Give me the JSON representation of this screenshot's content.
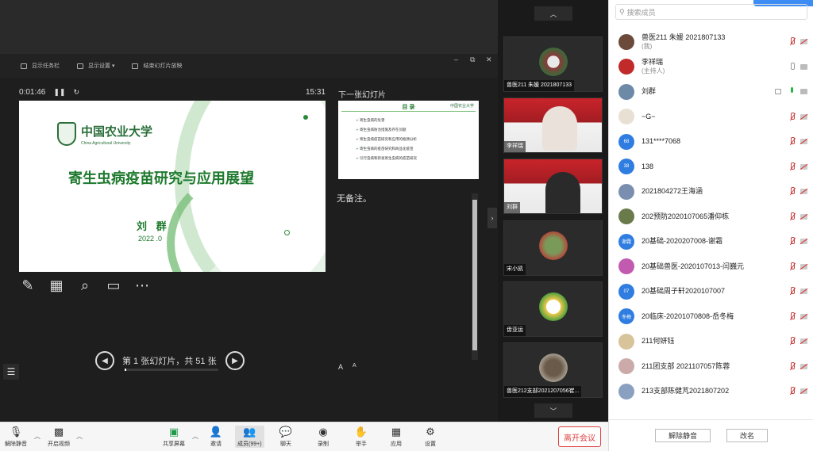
{
  "colors": {
    "accent_green": "#1f7a2e",
    "leave_red": "#e04040",
    "panel_bg": "#1e1e1e"
  },
  "presenter": {
    "toolbar": [
      "显示任务栏",
      "显示设置 ▾",
      "结束幻灯片放映"
    ],
    "window_controls": [
      "–",
      "⧉",
      "✕"
    ],
    "elapsed": "0:01:46",
    "clock": "15:31",
    "next_slide_label": "下一张幻灯片",
    "notes": "无备注。",
    "slide_counter": "第 1 张幻灯片，共 51 张",
    "progress_fraction": 0.02,
    "font_controls": [
      "A",
      "A"
    ]
  },
  "slide": {
    "logo_cn": "中国农业大学",
    "logo_en": "China Agricultural University",
    "title": "寄生虫病疫苗研究与应用展望",
    "author": "刘 群",
    "date": "2022 .0"
  },
  "next_slide": {
    "heading": "目 录",
    "logo": "中国农业大学",
    "items": [
      "寄生虫病的危害",
      "寄生虫病防治措施及存在问题",
      "寄生虫病疫苗研究和应用的瓶颈分析",
      "寄生虫病的疫苗研究和商品化疫苗",
      "引行虫病和新发寄生虫病的疫苗研究"
    ]
  },
  "videos": [
    {
      "name": "兽医211 朱媛 2021807133"
    },
    {
      "name": "李祥瑞"
    },
    {
      "name": "刘群"
    },
    {
      "name": "宋小凯"
    },
    {
      "name": "毋亚运"
    },
    {
      "name": "兽医212支部2021207056崔..."
    }
  ],
  "members": {
    "search_placeholder": "搜索成员",
    "list": [
      {
        "name": "兽医211 朱媛 2021807133",
        "sub": "(我)",
        "avatar": "",
        "avatar_color": "#6b4a3a"
      },
      {
        "name": "李祥瑞",
        "sub": "(主持人)",
        "avatar": "",
        "avatar_color": "#c02a2a"
      },
      {
        "name": "刘群",
        "sub": "",
        "avatar": "",
        "avatar_color": "#6c89a8"
      },
      {
        "name": "~G~",
        "sub": "",
        "avatar": "",
        "avatar_color": "#e9e0d4"
      },
      {
        "name": "131****7068",
        "sub": "",
        "avatar": "68",
        "avatar_color": "#2f7de1"
      },
      {
        "name": "138",
        "sub": "",
        "avatar": "38",
        "avatar_color": "#2f7de1"
      },
      {
        "name": "2021804272王海涵",
        "sub": "",
        "avatar": "",
        "avatar_color": "#7a8fb0"
      },
      {
        "name": "202预防2020107065潘仰栋",
        "sub": "",
        "avatar": "",
        "avatar_color": "#6a7a4a"
      },
      {
        "name": "20基础-2020207008-谢霜",
        "sub": "",
        "avatar": "谢霜",
        "avatar_color": "#2f7de1"
      },
      {
        "name": "20基础兽医-2020107013-闫巍元",
        "sub": "",
        "avatar": "",
        "avatar_color": "#c25ab0"
      },
      {
        "name": "20基础周子轩2020107007",
        "sub": "",
        "avatar": "07",
        "avatar_color": "#2f7de1"
      },
      {
        "name": "20临床-20201070808-岳冬梅",
        "sub": "",
        "avatar": "冬梅",
        "avatar_color": "#2f7de1"
      },
      {
        "name": "211何妍钰",
        "sub": "",
        "avatar": "",
        "avatar_color": "#d8c49a"
      },
      {
        "name": "211团支部 2021107057陈蓉",
        "sub": "",
        "avatar": "",
        "avatar_color": "#caa"
      },
      {
        "name": "213支部陈健芃2021807202",
        "sub": "",
        "avatar": "",
        "avatar_color": "#8aa0c0"
      }
    ],
    "unmute_all": "解除静音",
    "rename": "改名"
  },
  "bottombar": {
    "unmute": "解除静音",
    "start_video": "开启视频",
    "share_screen": "共享屏幕",
    "invite": "邀请",
    "members": "成员(99+)",
    "chat": "聊天",
    "record": "录制",
    "raise_hand": "举手",
    "apps": "应用",
    "settings": "设置",
    "leave": "离开会议"
  }
}
